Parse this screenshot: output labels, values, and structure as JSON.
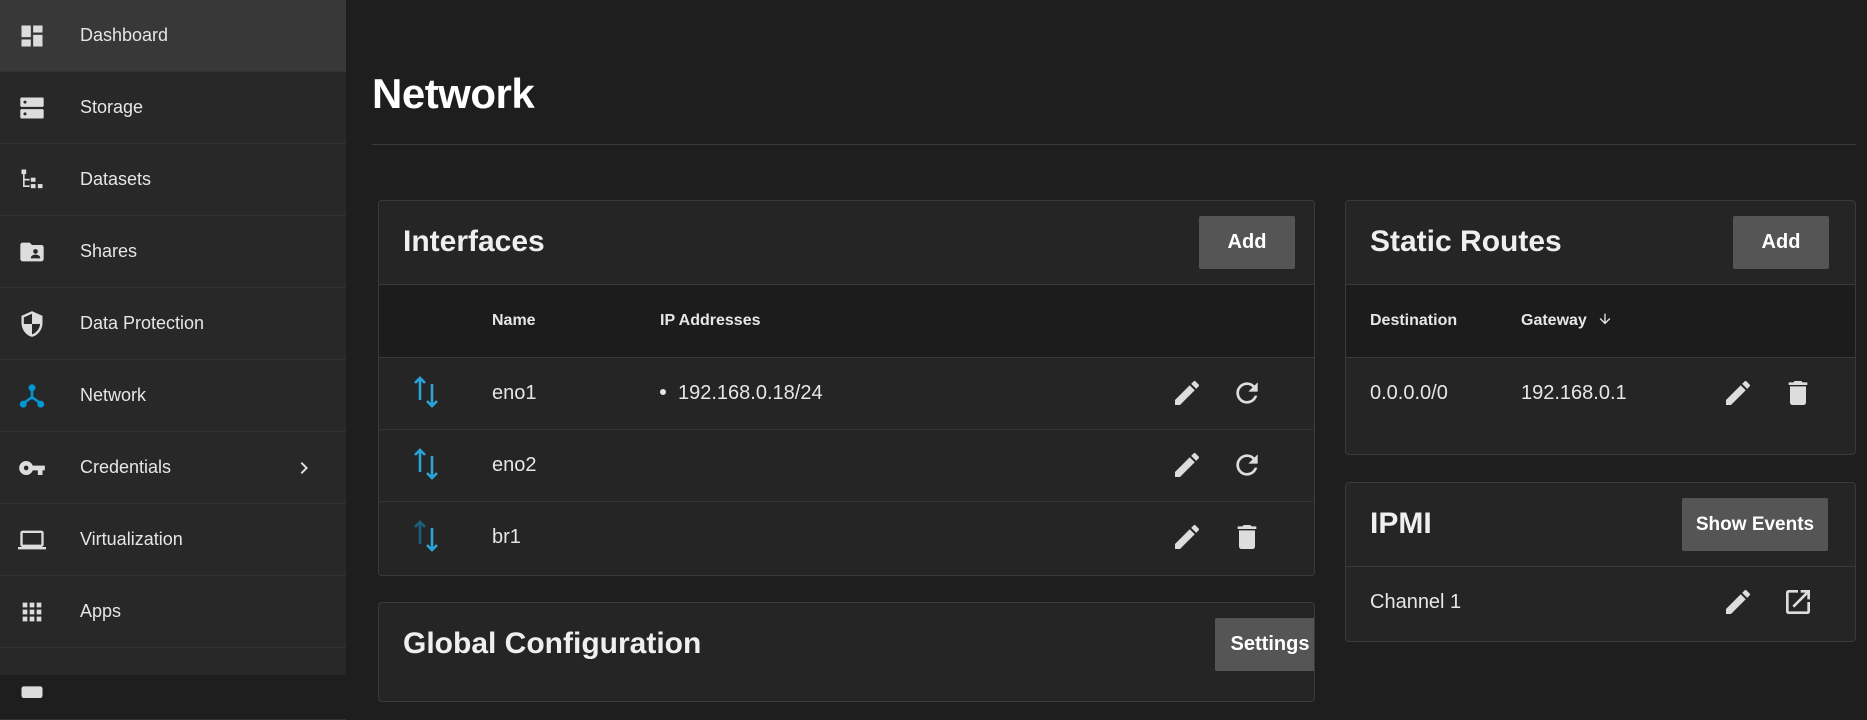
{
  "sidebar": {
    "items": [
      {
        "label": "Dashboard",
        "icon": "dashboard-icon"
      },
      {
        "label": "Storage",
        "icon": "storage-icon"
      },
      {
        "label": "Datasets",
        "icon": "datasets-icon"
      },
      {
        "label": "Shares",
        "icon": "shares-folder-icon"
      },
      {
        "label": "Data Protection",
        "icon": "shield-icon"
      },
      {
        "label": "Network",
        "icon": "network-icon"
      },
      {
        "label": "Credentials",
        "icon": "key-icon"
      },
      {
        "label": "Virtualization",
        "icon": "laptop-icon"
      },
      {
        "label": "Apps",
        "icon": "apps-grid-icon"
      }
    ]
  },
  "page": {
    "title": "Network"
  },
  "interfaces": {
    "title": "Interfaces",
    "add_label": "Add",
    "columns": {
      "name": "Name",
      "ip": "IP Addresses"
    },
    "rows": [
      {
        "name": "eno1",
        "ip": "192.168.0.18/24"
      },
      {
        "name": "eno2",
        "ip": ""
      },
      {
        "name": "br1",
        "ip": ""
      }
    ]
  },
  "global_config": {
    "title": "Global Configuration",
    "settings_label": "Settings"
  },
  "static_routes": {
    "title": "Static Routes",
    "add_label": "Add",
    "columns": {
      "destination": "Destination",
      "gateway": "Gateway"
    },
    "rows": [
      {
        "destination": "0.0.0.0/0",
        "gateway": "192.168.0.1"
      }
    ]
  },
  "ipmi": {
    "title": "IPMI",
    "show_events_label": "Show Events",
    "rows": [
      {
        "name": "Channel 1"
      }
    ]
  },
  "colors": {
    "accent": "#0095d5",
    "button": "#555555"
  }
}
